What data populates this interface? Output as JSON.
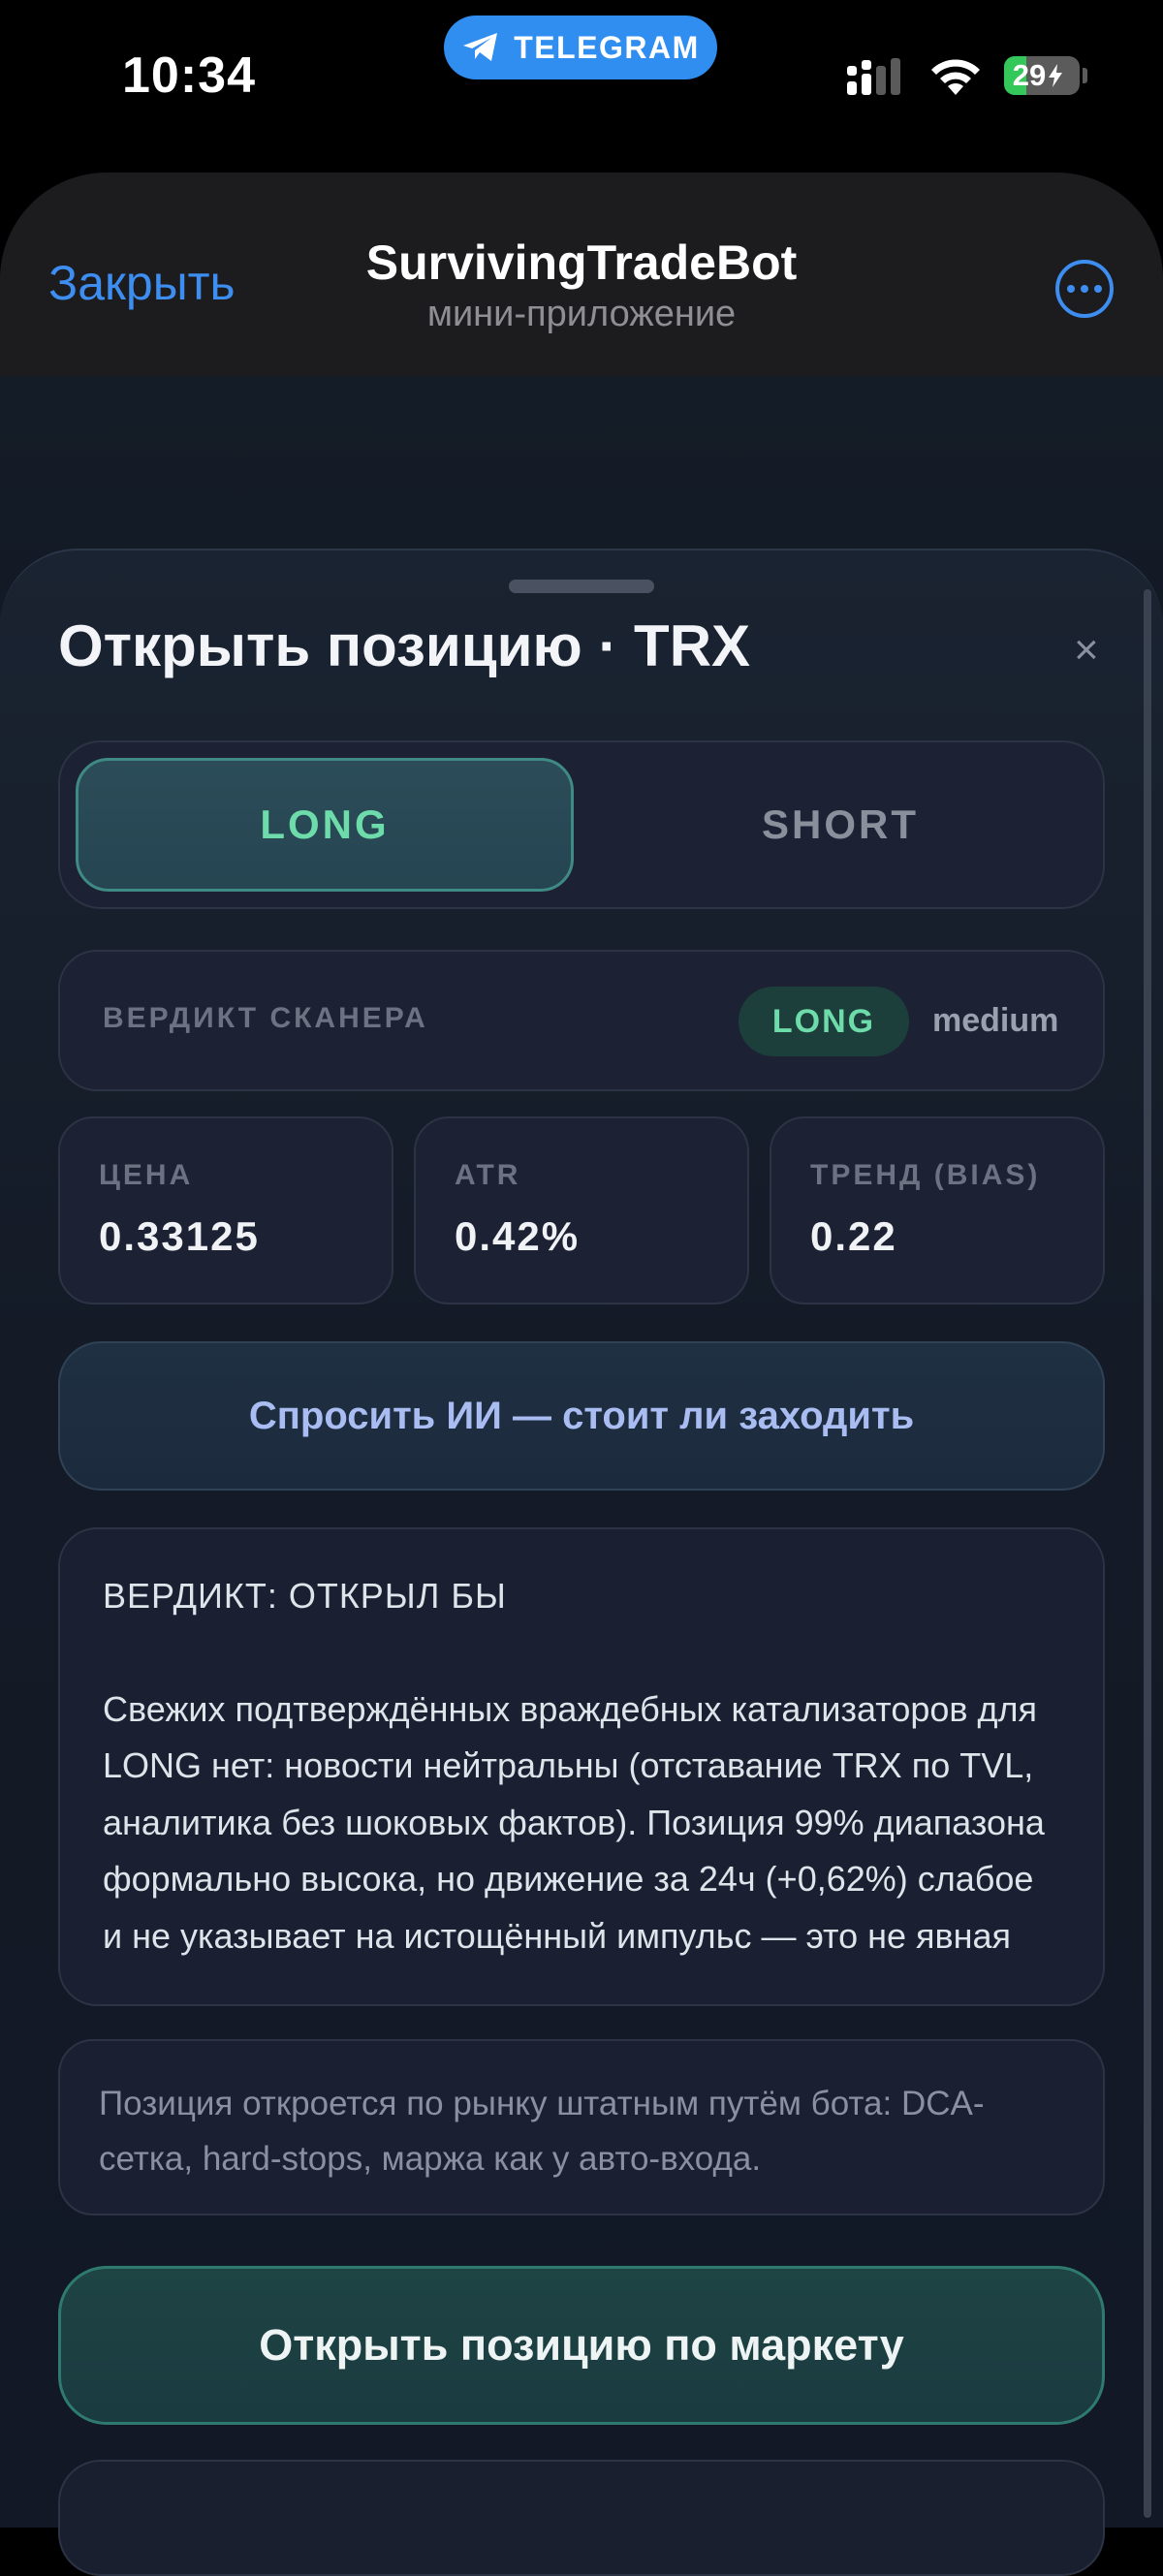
{
  "status_bar": {
    "time": "10:34",
    "app_pill": "TELEGRAM",
    "battery": "29"
  },
  "header": {
    "close_label": "Закрыть",
    "title": "SurvivingTradeBot",
    "subtitle": "мини-приложение"
  },
  "sheet": {
    "title": "Открыть позицию · TRX",
    "close_glyph": "×",
    "side_toggle": {
      "options": [
        "LONG",
        "SHORT"
      ],
      "selected": "LONG"
    },
    "scanner": {
      "label": "ВЕРДИКТ СКАНЕРА",
      "direction": "LONG",
      "confidence": "medium"
    },
    "metrics": [
      {
        "label": "ЦЕНА",
        "value": "0.33125"
      },
      {
        "label": "ATR",
        "value": "0.42%"
      },
      {
        "label": "ТРЕНД (BIAS)",
        "value": "0.22"
      }
    ],
    "ask_ai_label": "Спросить ИИ — стоит ли заходить",
    "ai_answer": {
      "heading": "ВЕРДИКТ: ОТКРЫЛ БЫ",
      "body": "Свежих подтверждённых враждебных катализаторов для LONG нет: новости нейтральны (отставание TRX по TVL, аналитика без шоковых фактов). Позиция 99% диапазона формально высока, но движение за 24ч (+0,62%) слабое и не указывает на истощённый импульс — это не явная"
    },
    "note": "Позиция откроется по рынку штатным путём бота: DCA-сетка, hard-stops, маржа как у авто-входа.",
    "submit_label": "Открыть позицию по маркету"
  },
  "colors": {
    "accent_blue": "#3d8ef0",
    "long_green": "#6edcaa",
    "ai_button_text": "#a9bdf2"
  }
}
